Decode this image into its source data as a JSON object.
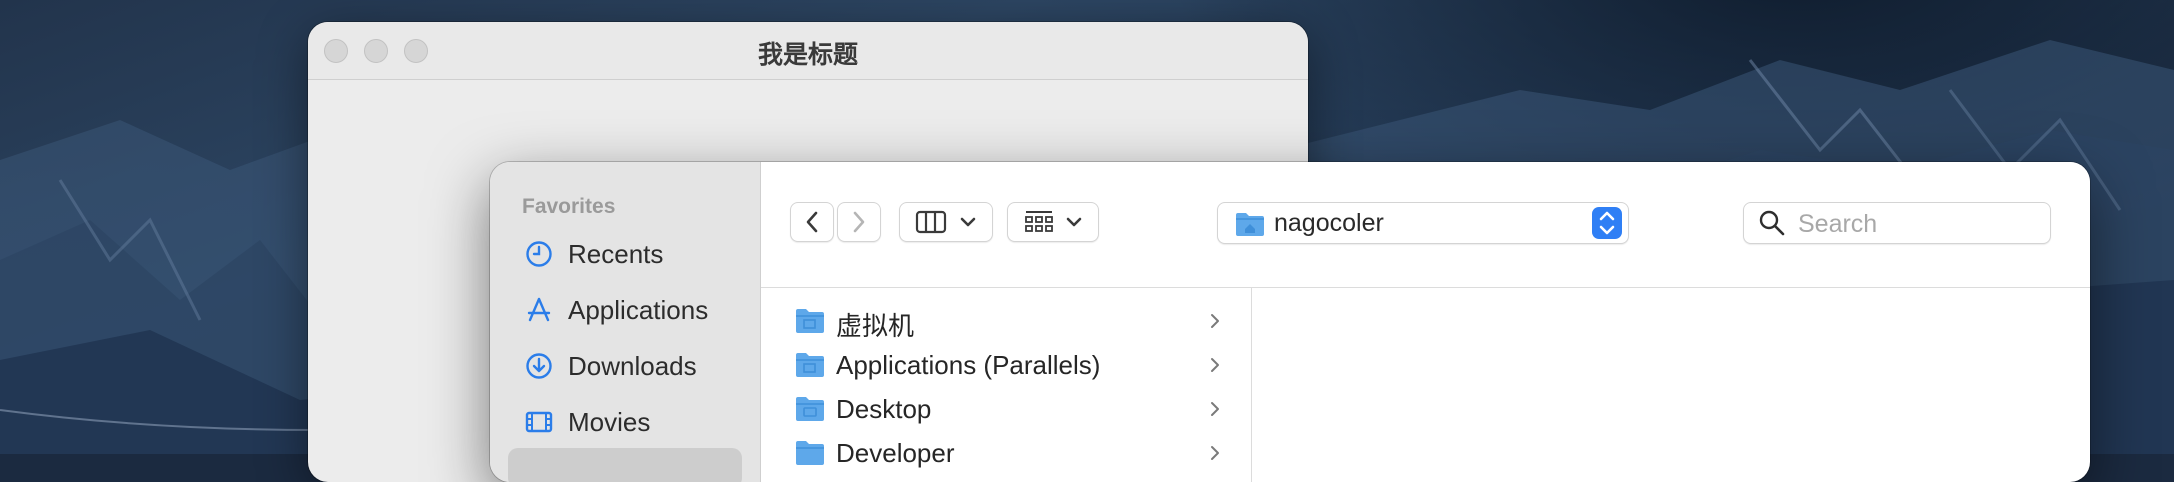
{
  "back_window": {
    "title": "我是标题"
  },
  "dialog": {
    "sidebar": {
      "heading": "Favorites",
      "items": [
        {
          "label": "Recents",
          "icon": "clock-icon"
        },
        {
          "label": "Applications",
          "icon": "applications-icon"
        },
        {
          "label": "Downloads",
          "icon": "download-icon"
        },
        {
          "label": "Movies",
          "icon": "film-icon"
        }
      ]
    },
    "toolbar": {
      "location": "nagocoler",
      "search_placeholder": "Search"
    },
    "files": [
      {
        "name": "虚拟机"
      },
      {
        "name": "Applications (Parallels)"
      },
      {
        "name": "Desktop"
      },
      {
        "name": "Developer"
      }
    ]
  },
  "colors": {
    "accent": "#2f7ff5",
    "folder": "#5ea8ea",
    "sidebar_icon": "#2b7de9"
  }
}
